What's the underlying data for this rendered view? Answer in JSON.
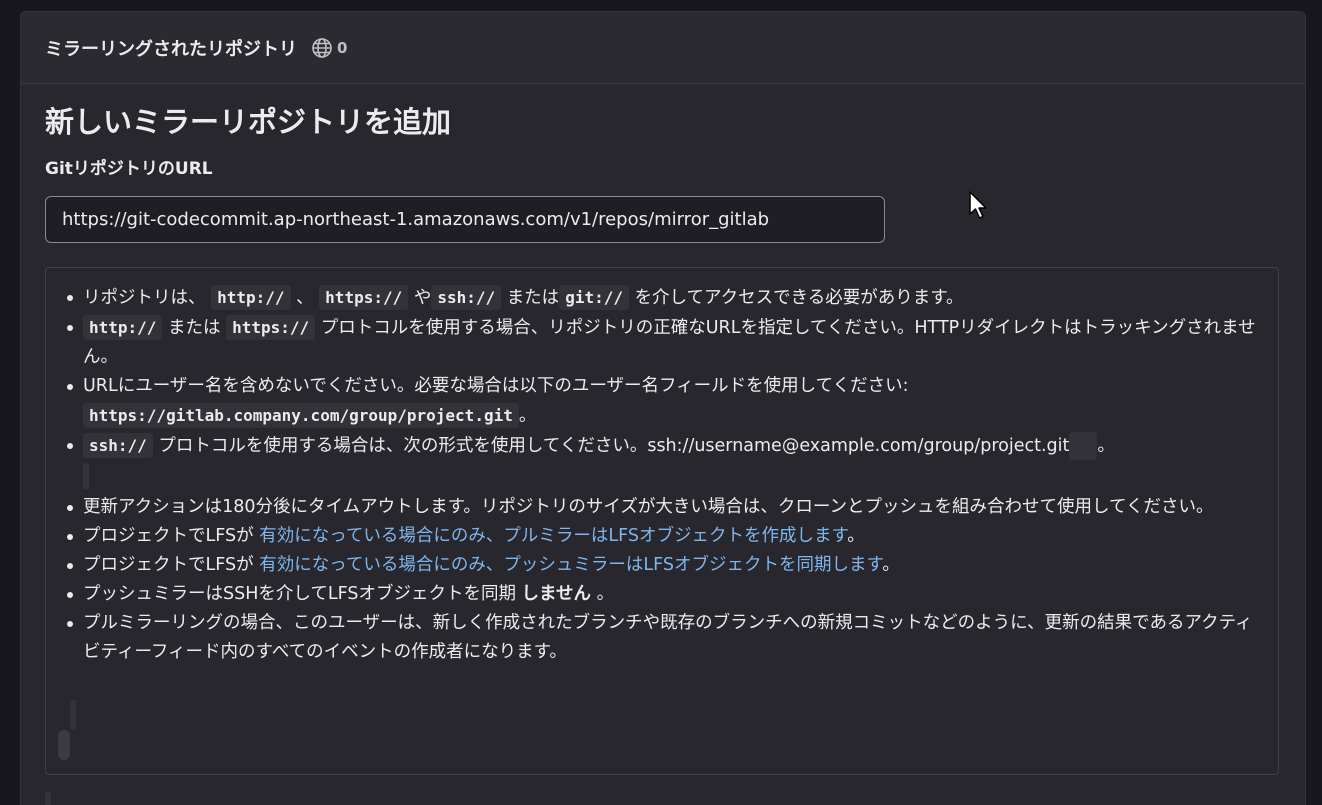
{
  "section": {
    "title": "ミラーリングされたリポジトリ",
    "count": "0",
    "icon": "globe-icon"
  },
  "form": {
    "heading": "新しいミラーリポジトリを追加",
    "url_label": "GitリポジトリのURL",
    "url_value": "https://git-codecommit.ap-northeast-1.amazonaws.com/v1/repos/mirror_gitlab"
  },
  "help": {
    "item1": {
      "t1": "リポジトリは、",
      "c1": "http://",
      "t2": "、",
      "c2": "https://",
      "t3": "や",
      "c3": "ssh://",
      "t4": "または",
      "c4": "git://",
      "t5": "を介してアクセスできる必要があります。"
    },
    "item2": {
      "c1": "http://",
      "t1": "または",
      "c2": "https://",
      "t2": "プロトコルを使用する場合、リポジトリの正確なURLを指定してください。HTTPリダイレクトはトラッキングされません。"
    },
    "item3": {
      "t1": "URLにユーザー名を含めないでください。必要な場合は以下のユーザー名フィールドを使用してください:",
      "c1": "https://gitlab.company.com/group/project.git",
      "t2": "。"
    },
    "item4": {
      "c1": "ssh://",
      "t1": "プロトコルを使用する場合は、次の形式を使用してください。ssh://username@example.com/group/project.git",
      "t2": "。"
    },
    "item5": "更新アクションは180分後にタイムアウトします。リポジトリのサイズが大きい場合は、クローンとプッシュを組み合わせて使用してください。",
    "item6": {
      "t1": "プロジェクトでLFSが",
      "link": "有効になっている場合にのみ、プルミラーはLFSオブジェクトを作成します",
      "t2": "。"
    },
    "item7": {
      "t1": "プロジェクトでLFSが",
      "link": "有効になっている場合にのみ、プッシュミラーはLFSオブジェクトを同期します",
      "t2": "。"
    },
    "item8": {
      "t1": "プッシュミラーはSSHを介してLFSオブジェクトを同期",
      "strong": "しません",
      "t2": "。"
    },
    "item9": "プルミラーリングの場合、このユーザーは、新しく作成されたブランチや既存のブランチへの新規コミットなどのように、更新の結果であるアクティビティーフィード内のすべてのイベントの作成者になります。"
  },
  "colors": {
    "background": "#18171d",
    "card": "#28272d",
    "link": "#7fb6ed",
    "text": "#ececef"
  }
}
